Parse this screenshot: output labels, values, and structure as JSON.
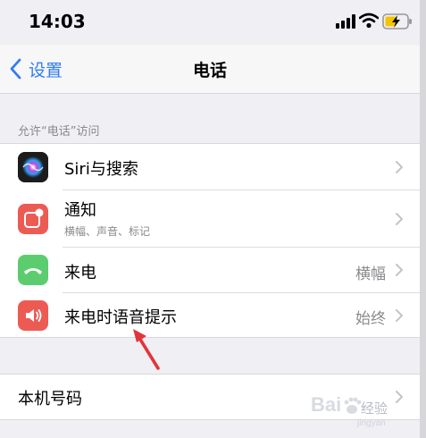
{
  "status_bar": {
    "time": "14:03"
  },
  "nav": {
    "back_label": "设置",
    "title": "电话"
  },
  "section": {
    "header": "允许“电话”访问"
  },
  "rows": {
    "siri": {
      "title": "Siri与搜索",
      "icon": "siri-icon"
    },
    "notifications": {
      "title": "通知",
      "subtitle": "横幅、声音、标记",
      "icon": "notifications-icon"
    },
    "incoming_calls": {
      "title": "来电",
      "value": "横幅",
      "icon": "phone-handset-icon"
    },
    "announce_calls": {
      "title": "来电时语音提示",
      "value": "始终",
      "icon": "speaker-icon"
    },
    "my_number": {
      "title": "本机号码"
    }
  },
  "watermark": {
    "text": "经验"
  },
  "colors": {
    "accent": "#2f7cf6",
    "notifications_icon_bg": "#ec5b53",
    "incoming_icon_bg": "#5ccd6f",
    "announce_icon_bg": "#ec5b53",
    "annotation_arrow": "#e0363a"
  }
}
